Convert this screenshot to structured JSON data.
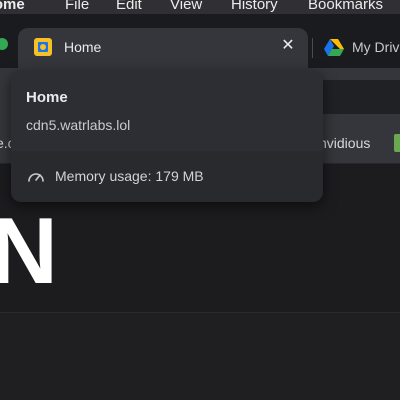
{
  "menu_bar": {
    "items": [
      "rome",
      "File",
      "Edit",
      "View",
      "History",
      "Bookmarks"
    ]
  },
  "tabs": {
    "active": {
      "title": "Home",
      "favicon": "google-slides-icon",
      "close": "✕"
    },
    "next": {
      "title": "My Driv",
      "favicon": "google-drive-icon"
    }
  },
  "bookmarks_bar": {
    "left_fragment": "e.c",
    "invidious_label": "nvidious"
  },
  "hover_card": {
    "title": "Home",
    "url": "cdn5.watrlabs.lol",
    "memory": "Memory usage: 179 MB",
    "memory_icon": "gauge-icon"
  },
  "page": {
    "logo_fragment": "N"
  },
  "colors": {
    "menu_bar": "#303034",
    "tab_strip": "#1a1b1f",
    "toolbar": "#34363b",
    "page_bg": "#1c1c1f",
    "hover_card": "#282a2e",
    "text_primary": "#e8eaed"
  }
}
